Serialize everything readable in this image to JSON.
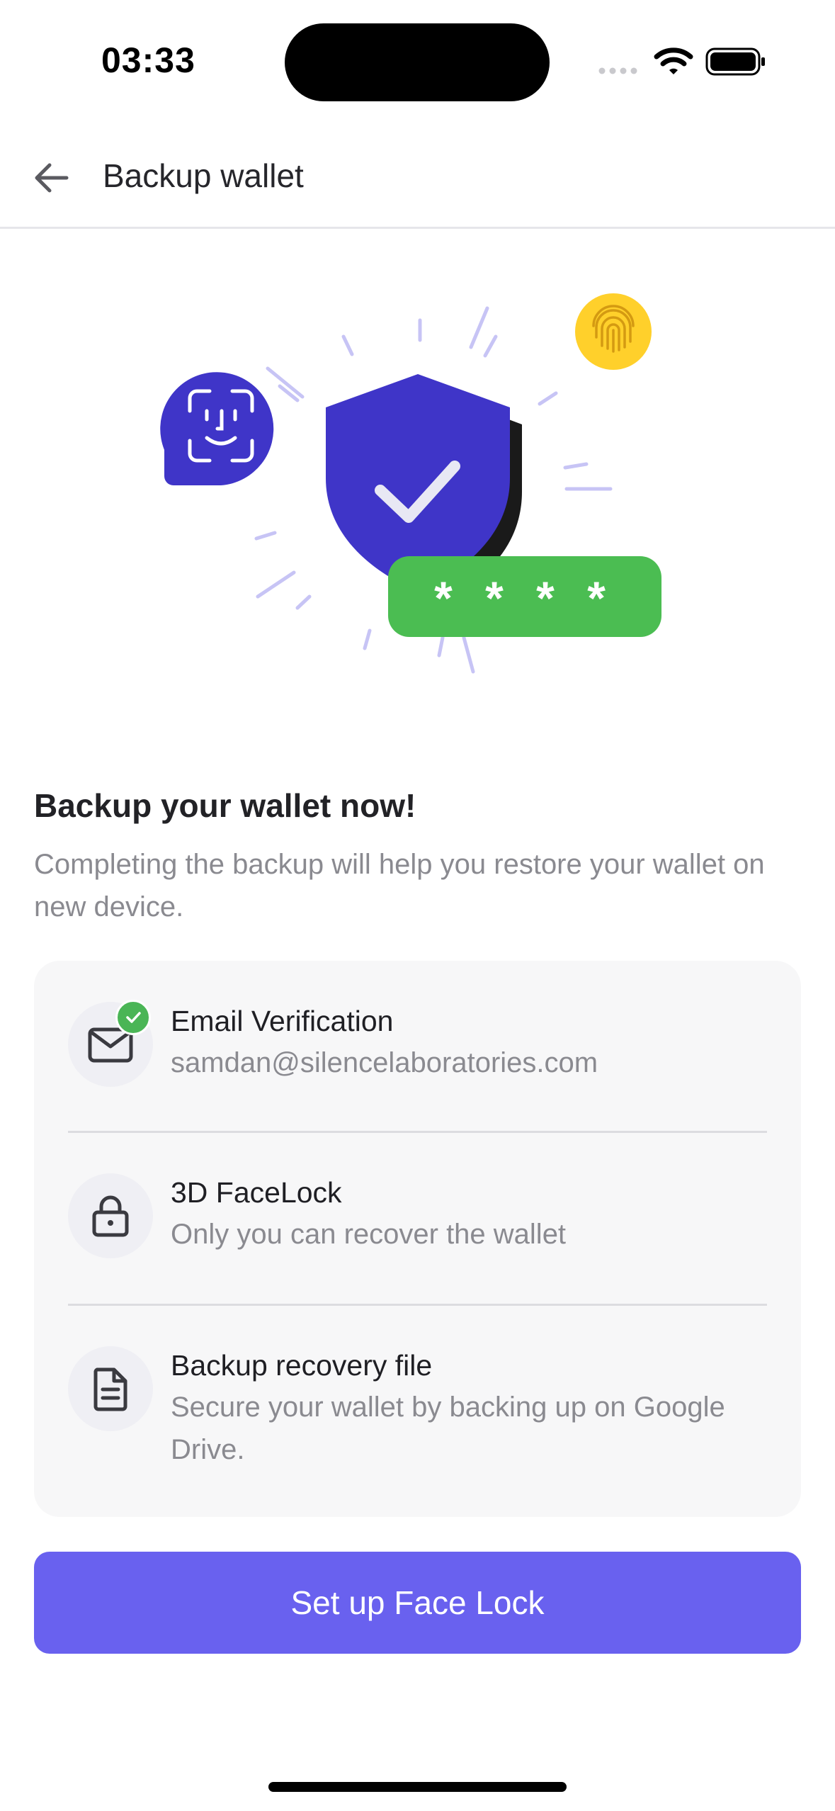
{
  "status_bar": {
    "time": "03:33"
  },
  "header": {
    "title": "Backup wallet",
    "back_icon": "arrow-left-icon"
  },
  "illustration": {
    "password_mask": "* * * *",
    "colors": {
      "shield": "#3f35c8",
      "faceid_bubble": "#3f35c8",
      "fingerprint_badge": "#ffd02b",
      "password_pill": "#4bbd52",
      "rays": "#c7c4f5"
    }
  },
  "intro": {
    "heading": "Backup your wallet now!",
    "description": "Completing the backup will help you restore your wallet on new device."
  },
  "steps": [
    {
      "title": "Email Verification",
      "description": "samdan@silencelaboratories.com",
      "icon": "mail-icon",
      "completed": true
    },
    {
      "title": "3D FaceLock",
      "description": "Only you can recover the wallet",
      "icon": "lock-icon",
      "completed": false
    },
    {
      "title": "Backup recovery file",
      "description": "Secure your wallet by backing up on Google Drive.",
      "icon": "document-icon",
      "completed": false
    }
  ],
  "primary_action": {
    "label": "Set up Face Lock",
    "color": "#6961ef"
  }
}
